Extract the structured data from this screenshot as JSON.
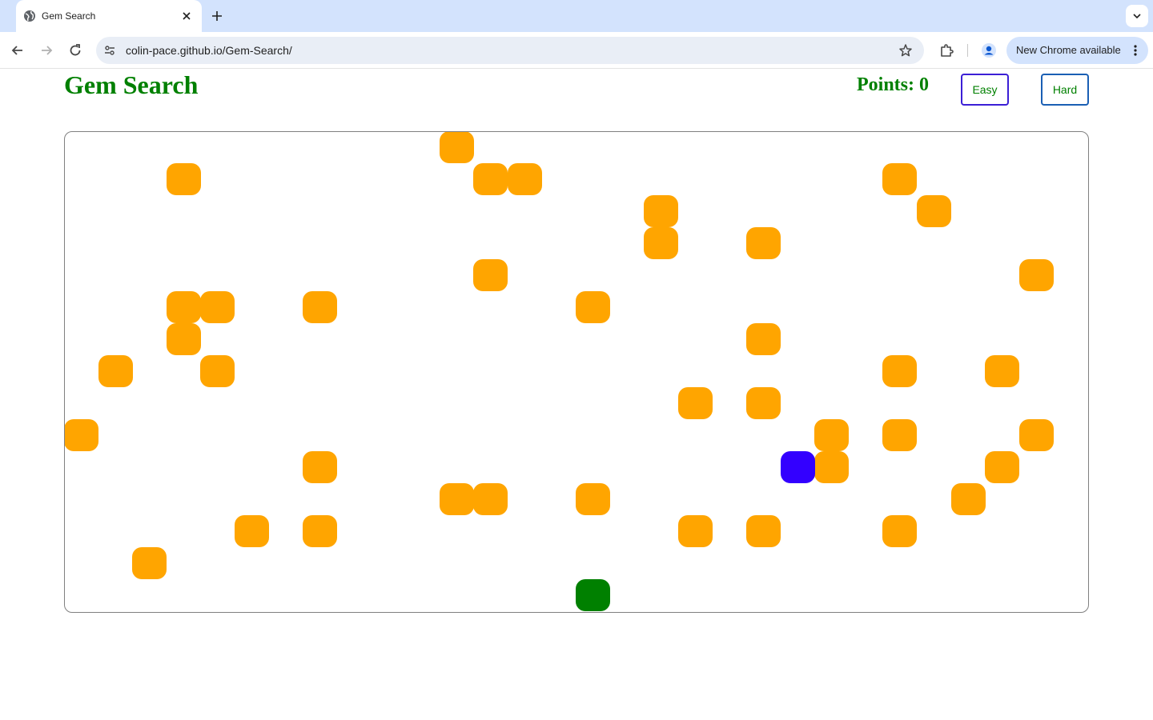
{
  "browser": {
    "tab_title": "Gem Search",
    "url": "colin-pace.github.io/Gem-Search/",
    "update_label": "New Chrome available",
    "icons": [
      "globe-icon",
      "close-icon",
      "plus-icon",
      "chevron-down-icon",
      "back-arrow-icon",
      "forward-arrow-icon",
      "reload-icon",
      "site-info-icon",
      "star-icon",
      "extensions-icon",
      "profile-icon",
      "more-vert-icon"
    ]
  },
  "page": {
    "title": "Gem Search",
    "points_label": "Points: 0",
    "easy_label": "Easy",
    "hard_label": "Hard"
  },
  "board": {
    "columns": 30,
    "rows": 15,
    "colors": {
      "wall": "#ffa500",
      "player": "#3300ff",
      "gem": "#008000"
    },
    "walls": [
      [
        11,
        0
      ],
      [
        3,
        1
      ],
      [
        12,
        1
      ],
      [
        13,
        1
      ],
      [
        24,
        1
      ],
      [
        17,
        2
      ],
      [
        25,
        2
      ],
      [
        17,
        3
      ],
      [
        20,
        3
      ],
      [
        12,
        4
      ],
      [
        28,
        4
      ],
      [
        3,
        5
      ],
      [
        4,
        5
      ],
      [
        7,
        5
      ],
      [
        15,
        5
      ],
      [
        3,
        6
      ],
      [
        20,
        6
      ],
      [
        1,
        7
      ],
      [
        4,
        7
      ],
      [
        24,
        7
      ],
      [
        27,
        7
      ],
      [
        18,
        8
      ],
      [
        20,
        8
      ],
      [
        0,
        9
      ],
      [
        22,
        9
      ],
      [
        24,
        9
      ],
      [
        28,
        9
      ],
      [
        7,
        10
      ],
      [
        22,
        10
      ],
      [
        27,
        10
      ],
      [
        11,
        11
      ],
      [
        12,
        11
      ],
      [
        15,
        11
      ],
      [
        26,
        11
      ],
      [
        5,
        12
      ],
      [
        7,
        12
      ],
      [
        18,
        12
      ],
      [
        20,
        12
      ],
      [
        24,
        12
      ],
      [
        2,
        13
      ]
    ],
    "player": [
      21,
      10
    ],
    "gem": [
      15,
      14
    ]
  }
}
